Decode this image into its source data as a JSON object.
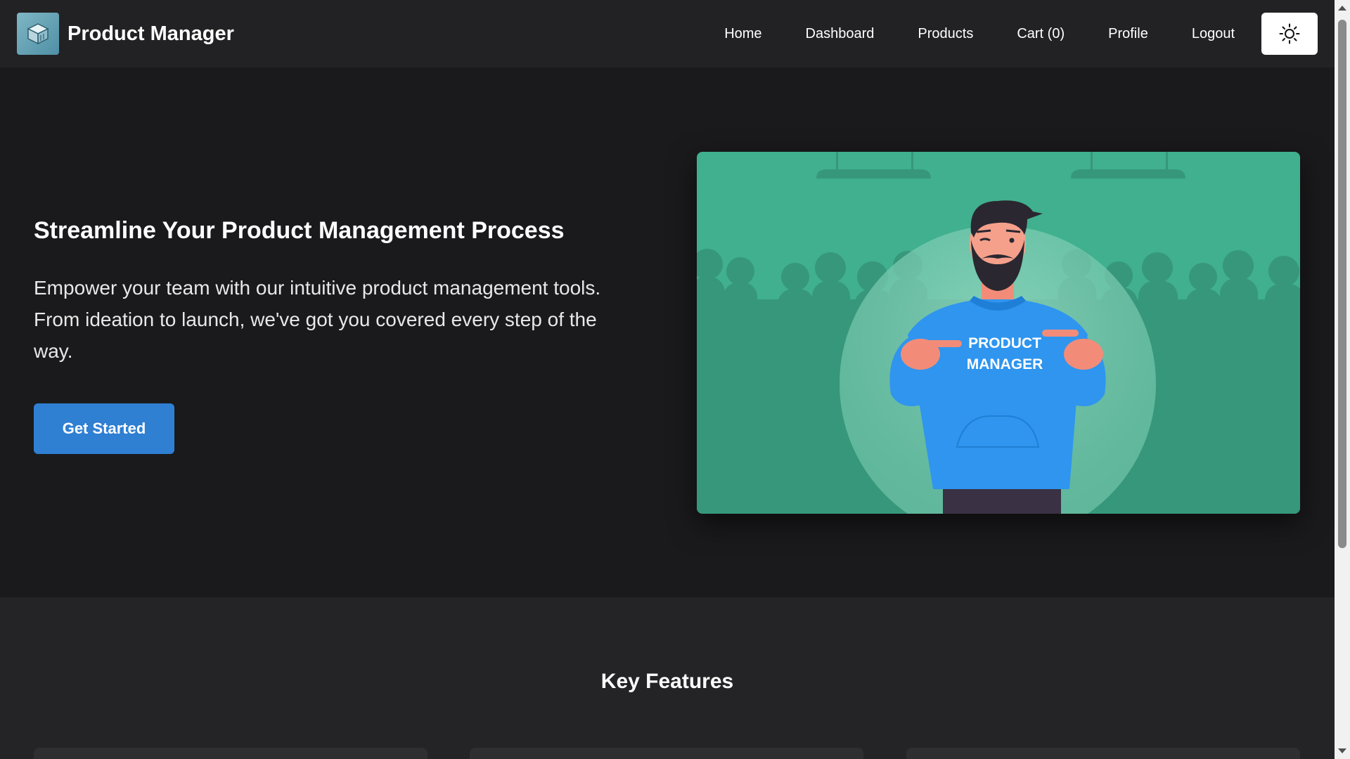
{
  "app": {
    "brand_title": "Product Manager"
  },
  "nav": {
    "items": [
      {
        "label": "Home"
      },
      {
        "label": "Dashboard"
      },
      {
        "label": "Products"
      },
      {
        "label": "Cart (0)"
      },
      {
        "label": "Profile"
      },
      {
        "label": "Logout"
      }
    ],
    "theme_toggle_icon": "sun-icon"
  },
  "hero": {
    "title": "Streamline Your Product Management Process",
    "description": "Empower your team with our intuitive product management tools. From ideation to launch, we've got you covered every step of the way.",
    "cta_label": "Get Started",
    "illustration": {
      "shirt_line1": "PRODUCT",
      "shirt_line2": "MANAGER"
    }
  },
  "features": {
    "title": "Key Features"
  },
  "colors": {
    "background": "#1a1a1c",
    "navbar": "#222224",
    "accent": "#2f7fd3",
    "illustration_bg": "#3fae8c",
    "shirt": "#2f95ef"
  }
}
